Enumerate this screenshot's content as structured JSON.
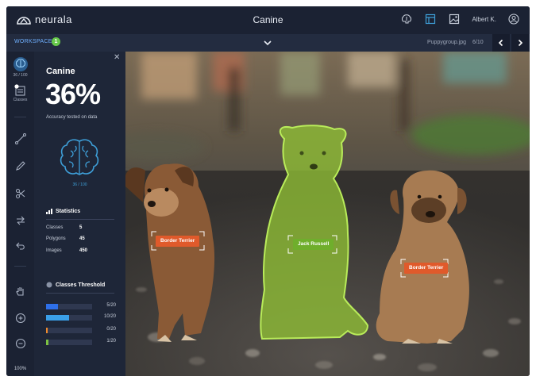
{
  "header": {
    "logo_text": "neurala",
    "title": "Canine",
    "user_name": "Albert K."
  },
  "workspace": {
    "label": "WORKSPACE",
    "badge": "1",
    "file_name": "Puppygroup.jpg",
    "file_position": "6/10"
  },
  "rail": {
    "items": [
      {
        "name": "brain",
        "label": "36 / 100"
      },
      {
        "name": "classes",
        "label": "Classes",
        "badge": "1"
      }
    ],
    "zoom": "100%"
  },
  "panel": {
    "title": "Canine",
    "accuracy": "36%",
    "subtitle": "Accuracy tested on data",
    "brain_caption": "36 / 100",
    "statistics": {
      "heading": "Statistics",
      "rows": [
        {
          "label": "Classes",
          "value": "5"
        },
        {
          "label": "Polygons",
          "value": "45"
        },
        {
          "label": "Images",
          "value": "450"
        }
      ]
    },
    "threshold": {
      "heading": "Classes Threshold",
      "rows": [
        {
          "value": "5/20",
          "fraction": 0.25,
          "color": "#2e6fe8"
        },
        {
          "value": "10/20",
          "fraction": 0.5,
          "color": "#3a9fe8"
        },
        {
          "value": "0/20",
          "fraction": 0.02,
          "color": "#f08a2c"
        },
        {
          "value": "1/20",
          "fraction": 0.05,
          "color": "#7cc242"
        }
      ]
    }
  },
  "labels": [
    {
      "text": "Border Terrier",
      "color": "#e05a2b"
    },
    {
      "text": "Jack Russell",
      "color": "#6fae2c"
    },
    {
      "text": "Border Terrier",
      "color": "#e05a2b"
    }
  ],
  "colors": {
    "accent_blue": "#3e9fd8",
    "badge_green": "#67c94a",
    "tag_orange": "#e05a2b",
    "selection_green": "#8ed12f"
  }
}
